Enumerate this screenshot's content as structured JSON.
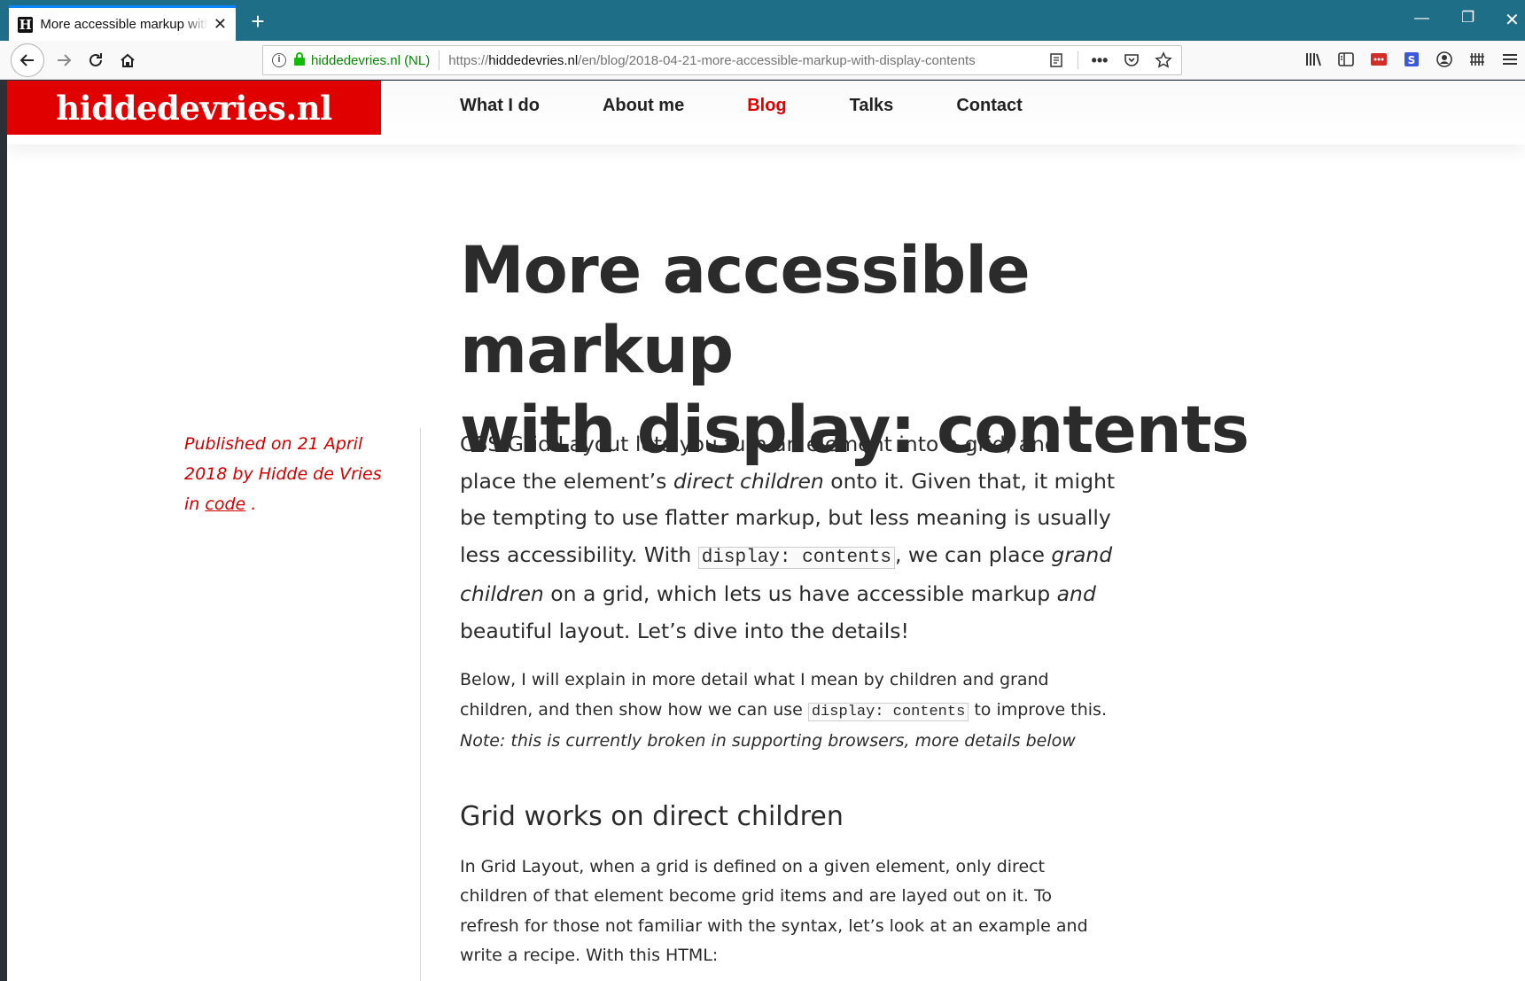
{
  "browser": {
    "tab_title": "More accessible markup with display: contents",
    "tab_favicon": "H",
    "url_identity": "hiddedevries.nl (NL)",
    "url_scheme": "https://",
    "url_host": "hiddedevries.nl",
    "url_path": "/en/blog/2018-04-21-more-accessible-markup-with-display-contents",
    "icons": [
      "back-icon",
      "forward-icon",
      "reload-icon",
      "home-icon",
      "info-icon",
      "lock-icon",
      "reader-view-icon",
      "page-actions-icon",
      "pocket-icon",
      "bookmark-star-icon",
      "library-icon",
      "sidebar-icon",
      "lastpass-icon",
      "extension-s-icon",
      "account-icon",
      "extension-grid-icon",
      "menu-icon"
    ]
  },
  "site": {
    "logo": "hiddedevries.nl",
    "nav": [
      {
        "label": "What I do"
      },
      {
        "label": "About me"
      },
      {
        "label": "Blog"
      },
      {
        "label": "Talks"
      },
      {
        "label": "Contact"
      }
    ],
    "active_nav": "Blog",
    "accent_color": "#e00000"
  },
  "article": {
    "title_line1": "More accessible markup",
    "title_line2": "with display: contents",
    "meta": {
      "published_prefix": "Published on",
      "date": "21 April 2018",
      "by": "by",
      "author": "Hidde de Vries",
      "in": "in",
      "category": "code",
      "end": "."
    },
    "lede": {
      "t1": "CSS Grid Layout lets you turn an element into a grid, and place the element’s ",
      "em1": "direct children",
      "t2": " onto it. Given that, it might be tempting to use flatter markup, but less meaning is usually less accessibility. With ",
      "code1": "display: contents",
      "t3": ", we can place ",
      "em2": "grand children",
      "t4": " on a grid, which lets us have accessible markup ",
      "em3": "and",
      "t5": " beautiful layout. Let’s dive into the details!"
    },
    "para1": {
      "t1": "Below, I will explain in more detail what I mean by children and grand children, and then show how we can use ",
      "code1": "display: contents",
      "t2": " to improve this. ",
      "note": "Note: this is currently broken in supporting browsers, more details below"
    },
    "heading1": "Grid works on direct children",
    "para2": "In Grid Layout, when a grid is defined on a given element, only direct children of that element become grid items and are layed out on it. To refresh for those not familiar with the syntax, let’s look at an example and write a recipe. With this HTML:"
  }
}
